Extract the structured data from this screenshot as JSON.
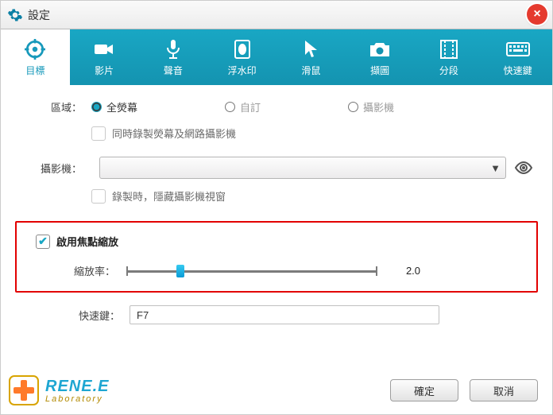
{
  "window": {
    "title": "設定",
    "close_icon": "×"
  },
  "tabs": [
    {
      "label": "目標"
    },
    {
      "label": "影片"
    },
    {
      "label": "聲音"
    },
    {
      "label": "浮水印"
    },
    {
      "label": "滑鼠"
    },
    {
      "label": "擷圖"
    },
    {
      "label": "分段"
    },
    {
      "label": "快速鍵"
    }
  ],
  "area": {
    "label": "區域：",
    "options": {
      "fullscreen": "全熒幕",
      "custom": "自訂",
      "camera": "攝影機"
    },
    "selected": "fullscreen",
    "dual_record_label": "同時錄製熒幕及網路攝影機"
  },
  "camera": {
    "label": "攝影機：",
    "selected": "",
    "hide_label": "錄製時，隱藏攝影機視窗"
  },
  "focus": {
    "enable_label": "啟用焦點縮放",
    "zoom_label": "縮放率：",
    "zoom_value": "2.0",
    "zoom_min": 1.0,
    "zoom_max": 6.0
  },
  "hotkey": {
    "label": "快速鍵：",
    "value": "F7"
  },
  "logo": {
    "brand": "RENE.E",
    "sub": "Laboratory"
  },
  "buttons": {
    "ok": "確定",
    "cancel": "取消"
  }
}
